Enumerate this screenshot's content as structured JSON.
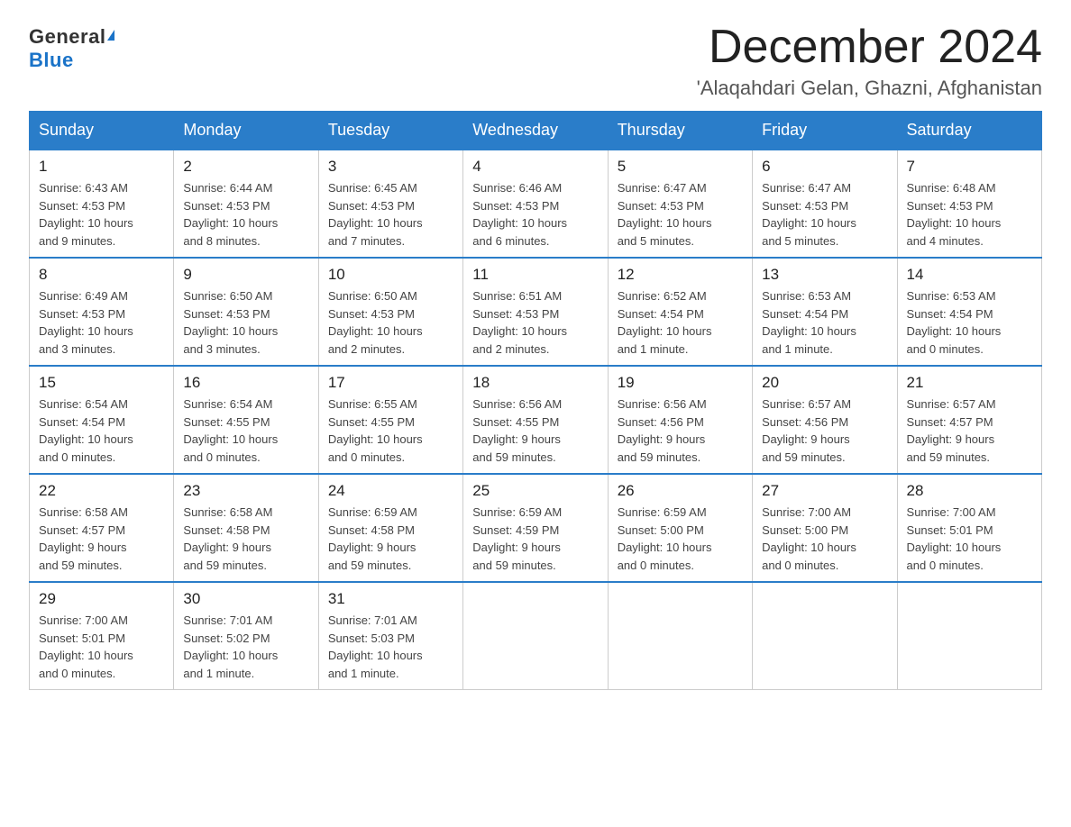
{
  "logo": {
    "general": "General",
    "blue": "Blue"
  },
  "title": "December 2024",
  "location": "'Alaqahdari Gelan, Ghazni, Afghanistan",
  "days_of_week": [
    "Sunday",
    "Monday",
    "Tuesday",
    "Wednesday",
    "Thursday",
    "Friday",
    "Saturday"
  ],
  "weeks": [
    [
      {
        "day": "1",
        "info": "Sunrise: 6:43 AM\nSunset: 4:53 PM\nDaylight: 10 hours\nand 9 minutes."
      },
      {
        "day": "2",
        "info": "Sunrise: 6:44 AM\nSunset: 4:53 PM\nDaylight: 10 hours\nand 8 minutes."
      },
      {
        "day": "3",
        "info": "Sunrise: 6:45 AM\nSunset: 4:53 PM\nDaylight: 10 hours\nand 7 minutes."
      },
      {
        "day": "4",
        "info": "Sunrise: 6:46 AM\nSunset: 4:53 PM\nDaylight: 10 hours\nand 6 minutes."
      },
      {
        "day": "5",
        "info": "Sunrise: 6:47 AM\nSunset: 4:53 PM\nDaylight: 10 hours\nand 5 minutes."
      },
      {
        "day": "6",
        "info": "Sunrise: 6:47 AM\nSunset: 4:53 PM\nDaylight: 10 hours\nand 5 minutes."
      },
      {
        "day": "7",
        "info": "Sunrise: 6:48 AM\nSunset: 4:53 PM\nDaylight: 10 hours\nand 4 minutes."
      }
    ],
    [
      {
        "day": "8",
        "info": "Sunrise: 6:49 AM\nSunset: 4:53 PM\nDaylight: 10 hours\nand 3 minutes."
      },
      {
        "day": "9",
        "info": "Sunrise: 6:50 AM\nSunset: 4:53 PM\nDaylight: 10 hours\nand 3 minutes."
      },
      {
        "day": "10",
        "info": "Sunrise: 6:50 AM\nSunset: 4:53 PM\nDaylight: 10 hours\nand 2 minutes."
      },
      {
        "day": "11",
        "info": "Sunrise: 6:51 AM\nSunset: 4:53 PM\nDaylight: 10 hours\nand 2 minutes."
      },
      {
        "day": "12",
        "info": "Sunrise: 6:52 AM\nSunset: 4:54 PM\nDaylight: 10 hours\nand 1 minute."
      },
      {
        "day": "13",
        "info": "Sunrise: 6:53 AM\nSunset: 4:54 PM\nDaylight: 10 hours\nand 1 minute."
      },
      {
        "day": "14",
        "info": "Sunrise: 6:53 AM\nSunset: 4:54 PM\nDaylight: 10 hours\nand 0 minutes."
      }
    ],
    [
      {
        "day": "15",
        "info": "Sunrise: 6:54 AM\nSunset: 4:54 PM\nDaylight: 10 hours\nand 0 minutes."
      },
      {
        "day": "16",
        "info": "Sunrise: 6:54 AM\nSunset: 4:55 PM\nDaylight: 10 hours\nand 0 minutes."
      },
      {
        "day": "17",
        "info": "Sunrise: 6:55 AM\nSunset: 4:55 PM\nDaylight: 10 hours\nand 0 minutes."
      },
      {
        "day": "18",
        "info": "Sunrise: 6:56 AM\nSunset: 4:55 PM\nDaylight: 9 hours\nand 59 minutes."
      },
      {
        "day": "19",
        "info": "Sunrise: 6:56 AM\nSunset: 4:56 PM\nDaylight: 9 hours\nand 59 minutes."
      },
      {
        "day": "20",
        "info": "Sunrise: 6:57 AM\nSunset: 4:56 PM\nDaylight: 9 hours\nand 59 minutes."
      },
      {
        "day": "21",
        "info": "Sunrise: 6:57 AM\nSunset: 4:57 PM\nDaylight: 9 hours\nand 59 minutes."
      }
    ],
    [
      {
        "day": "22",
        "info": "Sunrise: 6:58 AM\nSunset: 4:57 PM\nDaylight: 9 hours\nand 59 minutes."
      },
      {
        "day": "23",
        "info": "Sunrise: 6:58 AM\nSunset: 4:58 PM\nDaylight: 9 hours\nand 59 minutes."
      },
      {
        "day": "24",
        "info": "Sunrise: 6:59 AM\nSunset: 4:58 PM\nDaylight: 9 hours\nand 59 minutes."
      },
      {
        "day": "25",
        "info": "Sunrise: 6:59 AM\nSunset: 4:59 PM\nDaylight: 9 hours\nand 59 minutes."
      },
      {
        "day": "26",
        "info": "Sunrise: 6:59 AM\nSunset: 5:00 PM\nDaylight: 10 hours\nand 0 minutes."
      },
      {
        "day": "27",
        "info": "Sunrise: 7:00 AM\nSunset: 5:00 PM\nDaylight: 10 hours\nand 0 minutes."
      },
      {
        "day": "28",
        "info": "Sunrise: 7:00 AM\nSunset: 5:01 PM\nDaylight: 10 hours\nand 0 minutes."
      }
    ],
    [
      {
        "day": "29",
        "info": "Sunrise: 7:00 AM\nSunset: 5:01 PM\nDaylight: 10 hours\nand 0 minutes."
      },
      {
        "day": "30",
        "info": "Sunrise: 7:01 AM\nSunset: 5:02 PM\nDaylight: 10 hours\nand 1 minute."
      },
      {
        "day": "31",
        "info": "Sunrise: 7:01 AM\nSunset: 5:03 PM\nDaylight: 10 hours\nand 1 minute."
      },
      null,
      null,
      null,
      null
    ]
  ]
}
